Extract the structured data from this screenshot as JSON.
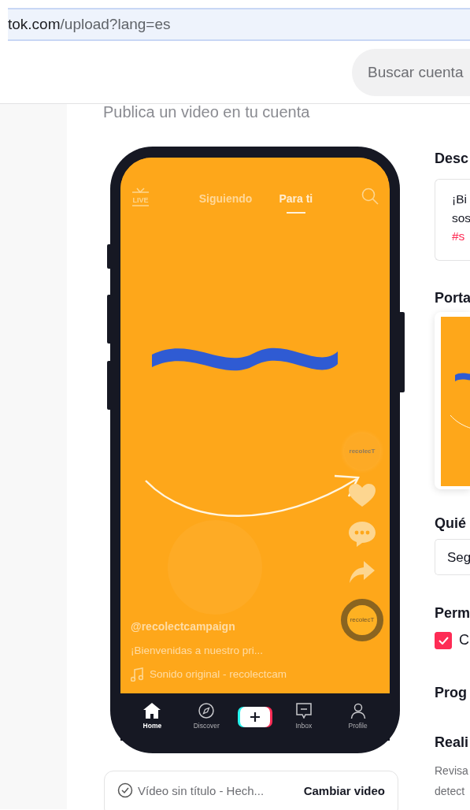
{
  "browser": {
    "url_host": "tok.com",
    "url_path": "/upload?lang=es"
  },
  "header": {
    "search": {
      "placeholder": "Buscar cuenta"
    }
  },
  "page": {
    "title": "Publica un video en tu cuenta"
  },
  "preview": {
    "live_icon_text": "LIVE",
    "top_tabs": [
      {
        "label": "Siguiendo",
        "selected": false
      },
      {
        "label": "Para ti",
        "selected": true
      }
    ],
    "avatar_text": "recolecT",
    "disc_text": "recolecT",
    "username": "@recolectcampaign",
    "caption": "¡Bienvenidas a nuestro pri...",
    "sound": "Sonido original - recolectcam",
    "nav": [
      {
        "kind": "home",
        "label": "Home",
        "selected": true
      },
      {
        "kind": "discover",
        "label": "Discover",
        "selected": false
      },
      {
        "kind": "create"
      },
      {
        "kind": "inbox",
        "label": "Inbox",
        "selected": false
      },
      {
        "kind": "profile",
        "label": "Profile",
        "selected": false
      }
    ]
  },
  "file": {
    "name": "Vídeo sin título - Hech...",
    "action": "Cambiar video"
  },
  "form": {
    "description": {
      "label": "Desc",
      "lines": [
        {
          "kind": "text",
          "text": "¡Bi"
        },
        {
          "kind": "text",
          "text": "sos"
        },
        {
          "kind": "hashtag",
          "text": "#s"
        }
      ]
    },
    "cover": {
      "label": "Porta"
    },
    "audience": {
      "label": "Quié",
      "value": "Seg"
    },
    "permissions": {
      "label": "Perm",
      "options": [
        {
          "label": "C",
          "checked": true
        }
      ]
    },
    "schedule": {
      "label": "Prog"
    },
    "checks": {
      "label": "Reali",
      "lines": [
        "Revisa",
        "detect"
      ]
    }
  }
}
